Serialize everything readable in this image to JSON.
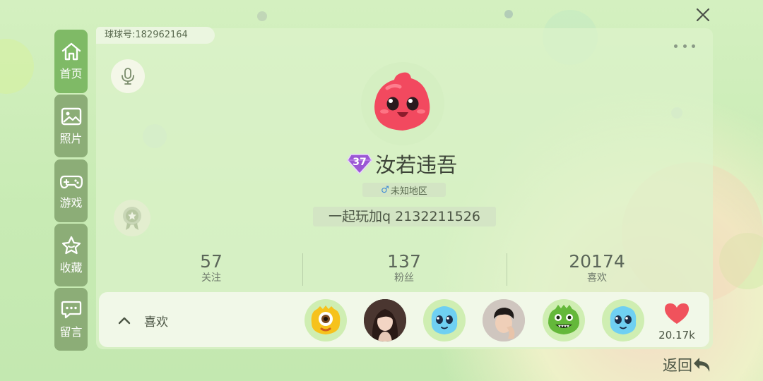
{
  "window": {
    "close_icon": "close-icon"
  },
  "sidebar": {
    "items": [
      {
        "label": "首页",
        "icon": "home-icon",
        "active": true
      },
      {
        "label": "照片",
        "icon": "photo-icon",
        "active": false
      },
      {
        "label": "游戏",
        "icon": "gamepad-icon",
        "active": false
      },
      {
        "label": "收藏",
        "icon": "star-icon",
        "active": false
      },
      {
        "label": "留言",
        "icon": "message-icon",
        "active": false
      }
    ]
  },
  "profile": {
    "id_label": "球球号:182962164",
    "level": "37",
    "nickname": "汝若违吾",
    "gender_symbol": "♂",
    "region": "未知地区",
    "signature": "一起玩加q 2132211526",
    "avatar": "pink-slime-avatar",
    "more_icon": "more-icon",
    "voice_icon": "microphone-icon",
    "medal_icon": "medal-icon"
  },
  "stats": [
    {
      "value": "57",
      "label": "关注"
    },
    {
      "value": "137",
      "label": "粉丝"
    },
    {
      "value": "20174",
      "label": "喜欢"
    }
  ],
  "likes": {
    "label": "喜欢",
    "toggle_icon": "chevron-up-icon",
    "count": "20.17k",
    "heart_icon": "heart-icon",
    "likers": [
      "yellow-monster-avatar",
      "girl-photo-avatar",
      "blue-monster-avatar",
      "boy-photo-avatar",
      "green-monster-avatar",
      "blue-monster-avatar"
    ]
  },
  "footer": {
    "back_label": "返回",
    "back_icon": "back-arrow-icon"
  },
  "colors": {
    "accent": "#7fba66",
    "sidebar": "#8cad77",
    "heart": "#f0525c",
    "avatar_pink": "#f2495f"
  }
}
